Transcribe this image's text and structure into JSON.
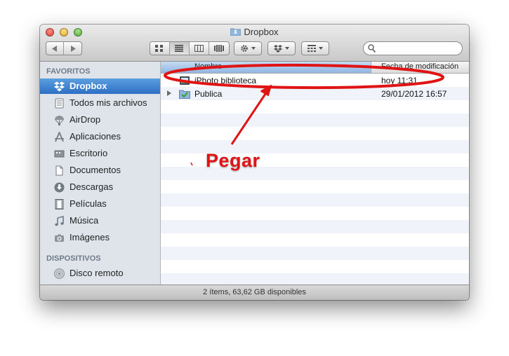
{
  "window": {
    "title": "Dropbox",
    "search": {
      "placeholder": "",
      "value": ""
    }
  },
  "sidebar": {
    "sections": [
      {
        "header": "FAVORITOS",
        "items": [
          {
            "label": "Dropbox",
            "icon": "dropbox-icon",
            "selected": true
          },
          {
            "label": "Todos mis archivos",
            "icon": "all-files-icon"
          },
          {
            "label": "AirDrop",
            "icon": "airdrop-icon"
          },
          {
            "label": "Aplicaciones",
            "icon": "applications-icon"
          },
          {
            "label": "Escritorio",
            "icon": "desktop-icon"
          },
          {
            "label": "Documentos",
            "icon": "documents-icon"
          },
          {
            "label": "Descargas",
            "icon": "downloads-icon"
          },
          {
            "label": "Películas",
            "icon": "movies-icon"
          },
          {
            "label": "Música",
            "icon": "music-icon"
          },
          {
            "label": "Imágenes",
            "icon": "pictures-icon"
          }
        ]
      },
      {
        "header": "DISPOSITIVOS",
        "items": [
          {
            "label": "Disco remoto",
            "icon": "remote-disc-icon"
          }
        ]
      }
    ]
  },
  "file_list": {
    "columns": {
      "name": "Nombre",
      "date": "Fecha de modificación"
    },
    "rows": [
      {
        "name": "iPhoto biblioteca",
        "date": "hoy 11:31",
        "icon": "iphoto-library-icon"
      },
      {
        "name": "Publica",
        "date": "29/01/2012 16:57",
        "icon": "shared-folder-icon",
        "expandable": true
      }
    ]
  },
  "status_bar": {
    "text": "2 ítems, 63,62 GB disponibles"
  },
  "annotation": {
    "label": "Pegar",
    "color": "#e01414"
  },
  "colors": {
    "selection": "#2c6fc4",
    "sidebar_bg": "#dfe4ea",
    "annotation": "#e01414"
  }
}
